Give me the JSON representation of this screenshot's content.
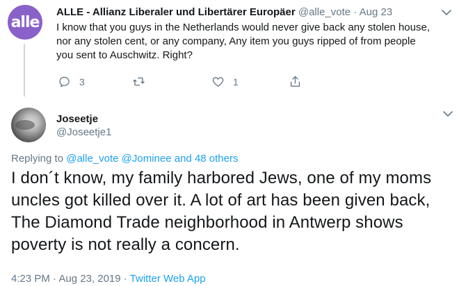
{
  "parent_tweet": {
    "avatar_text": "alle",
    "name": "ALLE - Allianz Liberaler und Libertärer Europäer",
    "handle": "@alle_vote",
    "dot": "·",
    "date": "Aug 23",
    "text": "I know that you guys in the Netherlands would never give back any stolen house, nor any stolen cent, or any company, Any item you guys ripped of from people you sent to Auschwitz. Right?",
    "reply_count": "3",
    "retweet_count": "",
    "like_count": "1",
    "icons": [
      "reply-icon",
      "retweet-icon",
      "like-icon",
      "share-icon",
      "chevron-down-icon"
    ]
  },
  "main_tweet": {
    "name": "Joseetje",
    "handle": "@Joseetje1",
    "replying_prefix": "Replying to",
    "replying_mentions": "@alle_vote @Jominee and 48 others",
    "text": "I don´t know, my family harbored Jews, one of my moms uncles got killed over it. A lot of art has been given back, The Diamond Trade neighborhood in Antwerp shows poverty is not really a concern.",
    "time": "4:23 PM · Aug 23, 2019 · ",
    "source": "Twitter Web App"
  },
  "colors": {
    "text": "#14171a",
    "secondary": "#657786",
    "link": "#1da1f2",
    "avatar_brand": "#8a60c9",
    "divider": "#ccd6dd"
  }
}
